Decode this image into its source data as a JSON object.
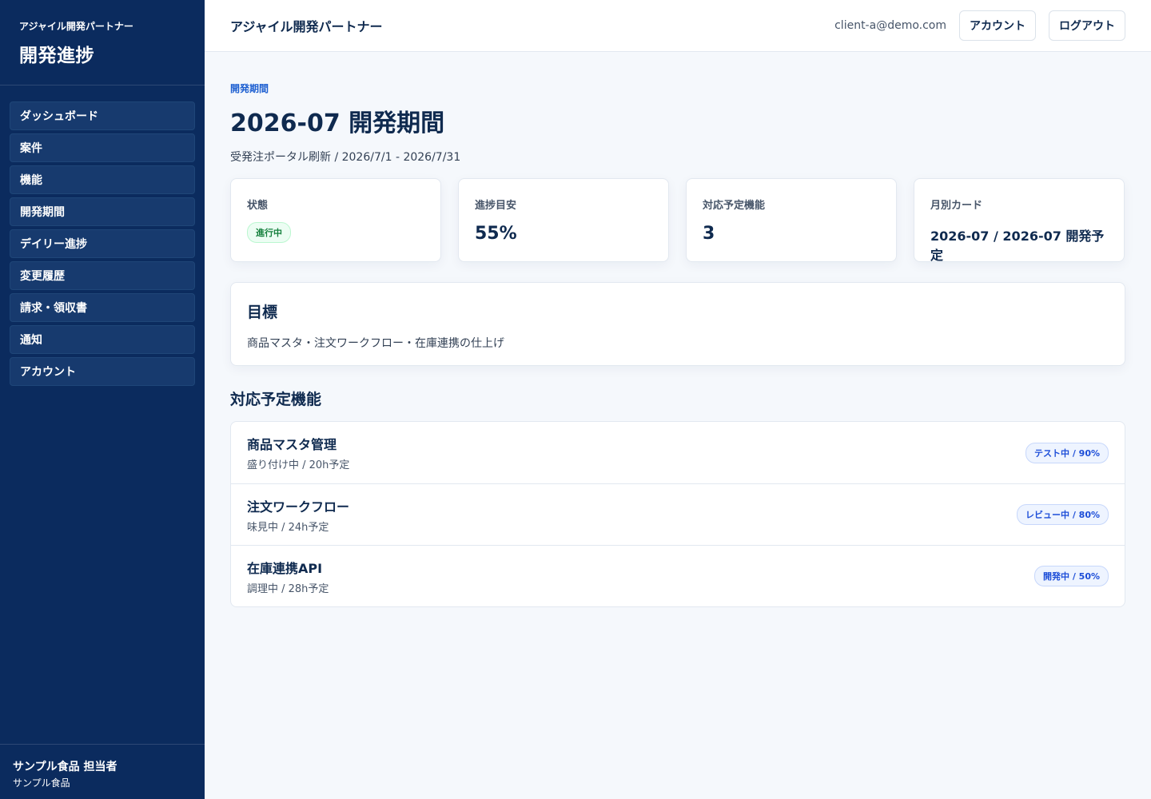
{
  "sidebar": {
    "brand_sub": "アジャイル開発パートナー",
    "brand_title": "開発進捗",
    "items": [
      {
        "label": "ダッシュボード"
      },
      {
        "label": "案件"
      },
      {
        "label": "機能"
      },
      {
        "label": "開発期間"
      },
      {
        "label": "デイリー進捗"
      },
      {
        "label": "変更履歴"
      },
      {
        "label": "請求・領収書"
      },
      {
        "label": "通知"
      },
      {
        "label": "アカウント"
      }
    ],
    "user_name": "サンプル食品 担当者",
    "user_company": "サンプル食品"
  },
  "header": {
    "title": "アジャイル開発パートナー",
    "email": "client-a@demo.com",
    "account_label": "アカウント",
    "logout_label": "ログアウト"
  },
  "page": {
    "eyebrow": "開発期間",
    "title": "2026-07 開発期間",
    "subtitle": "受発注ポータル刷新 / 2026/7/1 - 2026/7/31"
  },
  "cards": {
    "status_label": "状態",
    "status_value": "進行中",
    "progress_label": "進捗目安",
    "progress_value": "55%",
    "features_label": "対応予定機能",
    "features_value": "3",
    "monthly_label": "月別カード",
    "monthly_value": "2026-07 / 2026-07 開発予定"
  },
  "goal": {
    "title": "目標",
    "text": "商品マスタ・注文ワークフロー・在庫連携の仕上げ"
  },
  "features": {
    "title": "対応予定機能",
    "items": [
      {
        "name": "商品マスタ管理",
        "meta": "盛り付け中 / 20h予定",
        "status": "テスト中 / 90%"
      },
      {
        "name": "注文ワークフロー",
        "meta": "味見中 / 24h予定",
        "status": "レビュー中 / 80%"
      },
      {
        "name": "在庫連携API",
        "meta": "調理中 / 28h予定",
        "status": "開発中 / 50%"
      }
    ]
  },
  "colors": {
    "sidebar_bg": "#0b2b5e",
    "accent": "#1d5fd1",
    "status_ok": "#15803d"
  }
}
